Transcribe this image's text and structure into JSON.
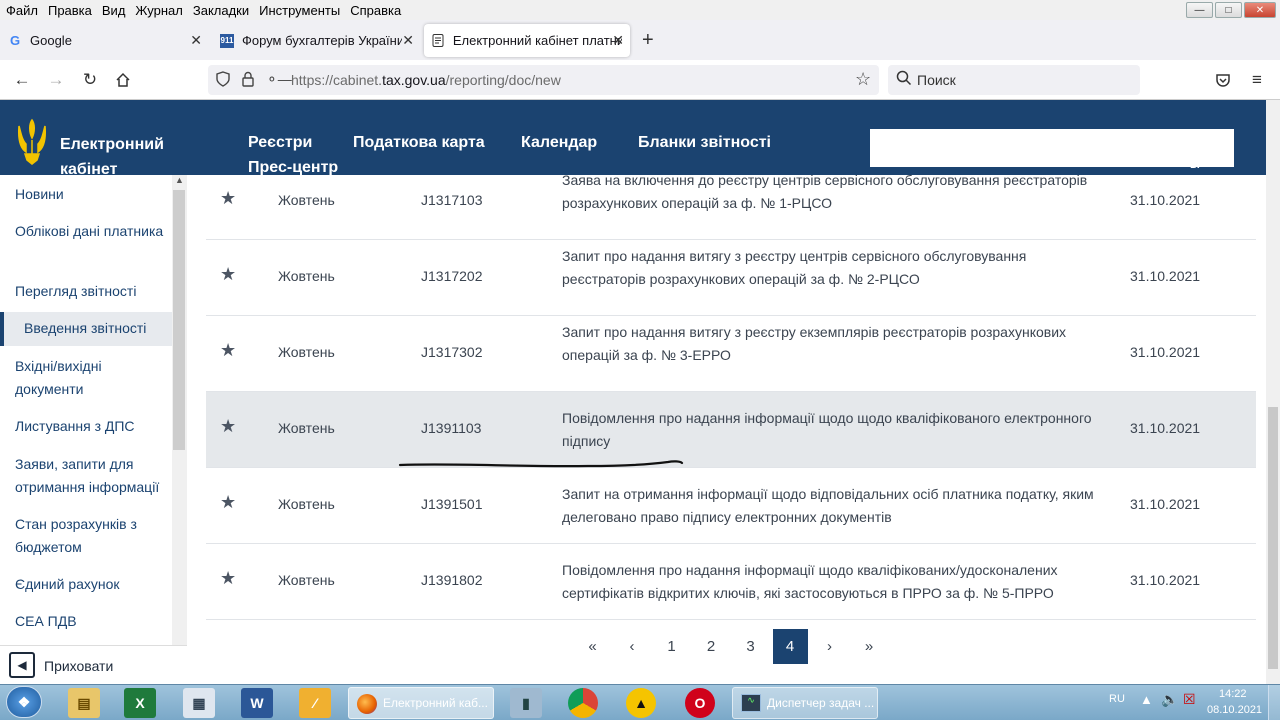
{
  "menubar": {
    "items": [
      "Файл",
      "Правка",
      "Вид",
      "Журнал",
      "Закладки",
      "Инструменты",
      "Справка"
    ]
  },
  "tabs": [
    {
      "title": "Google",
      "icon": "google-icon"
    },
    {
      "title": "Форум бухгалтерів України | Б",
      "icon": "forum-icon"
    },
    {
      "title": "Електронний кабінет платника",
      "icon": "page-icon",
      "active": true
    }
  ],
  "nav": {
    "url_prefix": "https://cabinet.",
    "url_domain": "tax.gov.ua",
    "url_path": "/reporting/doc/new",
    "search_placeholder": "Поиск"
  },
  "header": {
    "brand_line1": "Електронний",
    "brand_line2": "кабінет",
    "nav": [
      "Реєстри",
      "Податкова карта",
      "Календар",
      "Бланки звітності",
      "Прес-центр"
    ],
    "overflow_char": "в."
  },
  "sidebar": {
    "items": [
      {
        "label": "Новини"
      },
      {
        "label": "Облікові дані платника"
      },
      {
        "label": "Перегляд звітності"
      },
      {
        "label": "Введення звітності",
        "active": true
      },
      {
        "label": "Вхідні/вихідні документи"
      },
      {
        "label": "Листування з ДПС"
      },
      {
        "label": "Заяви, запити для отримання інформації"
      },
      {
        "label": "Стан розрахунків з бюджетом"
      },
      {
        "label": "Єдиний рахунок"
      },
      {
        "label": "СЕА ПДВ"
      }
    ],
    "hide_label": "Приховати"
  },
  "table": {
    "rows": [
      {
        "month": "Жовтень",
        "code": "J1317103",
        "desc_line1": "Заява на включення до реєстру центрів сервісного обслуговування реєстраторів",
        "desc_line2": "розрахункових операцій за ф. № 1-РЦСО",
        "date": "31.10.2021"
      },
      {
        "month": "Жовтень",
        "code": "J1317202",
        "desc_line1": "Запит про надання витягу з реєстру центрів сервісного обслуговування",
        "desc_line2": "реєстраторів розрахункових операцій за ф. № 2-РЦСО",
        "date": "31.10.2021"
      },
      {
        "month": "Жовтень",
        "code": "J1317302",
        "desc_line1": "Запит про надання витягу з реєстру екземплярів реєстраторів розрахункових",
        "desc_line2": "операцій за ф. № 3-ЕРРО",
        "date": "31.10.2021"
      },
      {
        "month": "Жовтень",
        "code": "J1391103",
        "desc_line1": "Повідомлення про надання інформації щодо щодо кваліфікованого електронного",
        "desc_line2": "підпису",
        "date": "31.10.2021",
        "highlight": true
      },
      {
        "month": "Жовтень",
        "code": "J1391501",
        "desc_line1": "Запит на отримання інформації щодо відповідальних осіб платника податку, яким",
        "desc_line2": "делеговано право підпису електронних документів",
        "date": "31.10.2021"
      },
      {
        "month": "Жовтень",
        "code": "J1391802",
        "desc_line1": "Повідомлення про надання інформації щодо кваліфікованих/удосконалених",
        "desc_line2": "сертифікатів відкритих ключів, які застосовуються в ПРРО за ф. № 5-ПРРО",
        "date": "31.10.2021"
      }
    ]
  },
  "pagination": {
    "first": "«",
    "prev": "‹",
    "pages": [
      "1",
      "2",
      "3",
      "4"
    ],
    "current": "4",
    "next": "›",
    "last": "»"
  },
  "taskbar": {
    "window1": "Електронний каб...",
    "window2": "Диспетчер задач ...",
    "lang": "RU",
    "time": "14:22",
    "date": "08.10.2021"
  }
}
